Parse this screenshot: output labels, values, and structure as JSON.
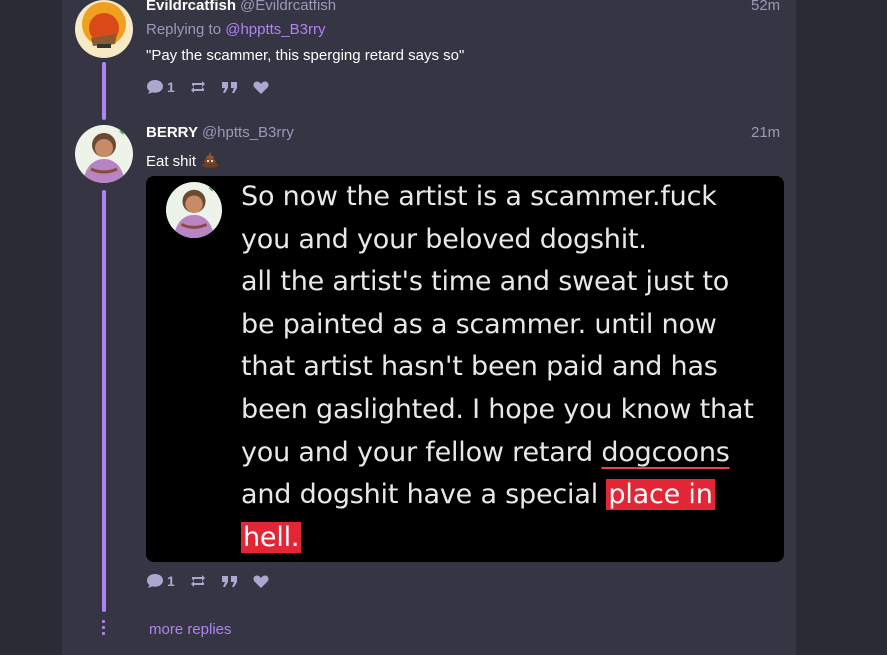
{
  "colors": {
    "accent": "#b084f0",
    "muted": "#9a9ab8",
    "panel": "#353544",
    "background": "#2b2b36",
    "highlight": "#e32636"
  },
  "post1": {
    "display_name": "Evildrcatfish",
    "handle": "@Evildrcatfish",
    "time": "52m",
    "replying_prefix": "Replying to",
    "replying_handle": "@hpptts_B3rry",
    "text": "\"Pay the scammer, this sperging retard says so\"",
    "reply_count": "1"
  },
  "post2": {
    "display_name": "BERRY",
    "handle": "@hptts_B3rry",
    "time": "21m",
    "text": "Eat shit",
    "emoji_icon": "pile-of-poo-icon",
    "reply_count": "1",
    "embed": {
      "line1": "So now the artist is a scammer.fuck",
      "line2": "you and your beloved dogshit.",
      "line3": "all the artist's time and sweat just to",
      "line4": "be painted as a scammer. until now",
      "line5": "that artist hasn't been paid and has",
      "line6": "been gaslighted. I hope you know that",
      "line7a": "you and your fellow retard ",
      "line7b": "dogcoons",
      "line8a": "and dogshit have a special ",
      "line8b": "place in",
      "line9": "hell."
    }
  },
  "thread": {
    "more_replies": "more replies"
  },
  "icons": [
    "comment-icon",
    "repeat-icon",
    "quote-icon",
    "heart-icon"
  ]
}
